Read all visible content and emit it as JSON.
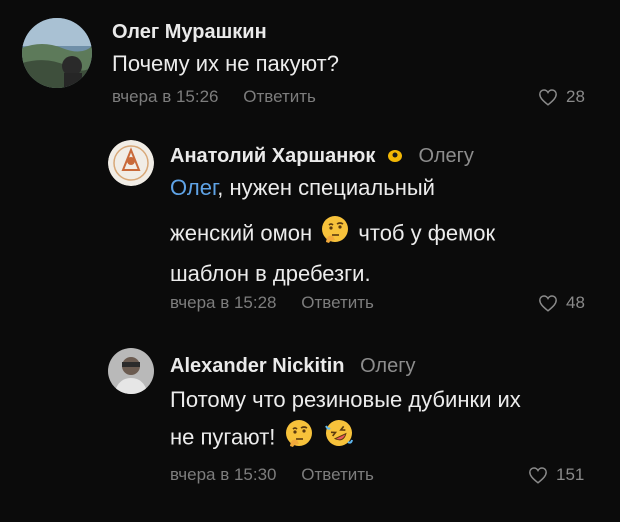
{
  "comments": [
    {
      "author": "Олег Мурашкин",
      "reply_to": "",
      "text": "Почему их не пакуют?",
      "time": "вчера в 15:26",
      "reply_label": "Ответить",
      "likes": "28"
    },
    {
      "author": "Анатолий Харшанюк",
      "reply_to": "Олегу",
      "mention": "Олег",
      "text_line1": ", нужен специальный",
      "text_line2": "женский омон",
      "text_line2_end": " чтоб у фемок",
      "text_line3": "шаблон в дребезги.",
      "time": "вчера в 15:28",
      "reply_label": "Ответить",
      "likes": "48"
    },
    {
      "author": "Alexander Nickitin",
      "reply_to": "Олегу",
      "text_line1": "Потому что резиновые дубинки их",
      "text_line2": "не пугают!",
      "time": "вчера в 15:30",
      "reply_label": "Ответить",
      "likes": "151"
    }
  ],
  "icons": {
    "heart": "heart-outline",
    "emoji_thinking": "thinking-face",
    "emoji_rofl": "rolling-on-the-floor-laughing",
    "badge": "yellow-badge"
  },
  "colors": {
    "background": "#0b0b0b",
    "mention": "#5fa3e6",
    "meta": "#7d7d7d"
  }
}
